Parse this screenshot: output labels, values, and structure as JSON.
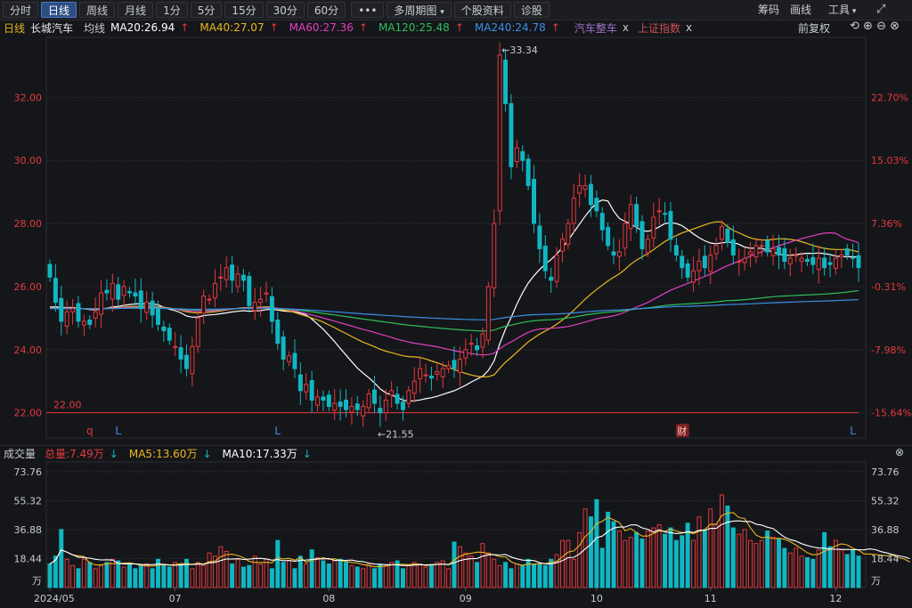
{
  "toolbar": {
    "periods": [
      "分时",
      "日线",
      "周线",
      "月线",
      "1分",
      "5分",
      "15分",
      "30分",
      "60分"
    ],
    "active": "日线",
    "more": "•••",
    "multi": "多周期图",
    "profile": "个股资料",
    "diagnose": "诊股",
    "chips": "筹码",
    "draw": "画线",
    "tools": "工具"
  },
  "info": {
    "period": "日线",
    "stock": "长城汽车",
    "avg": "均线",
    "ma20": "MA20:26.94",
    "ma40": "MA40:27.07",
    "ma60": "MA60:27.36",
    "ma120": "MA120:25.48",
    "ma240": "MA240:24.78",
    "overlay1": "汽车整车",
    "overlay2": "上证指数",
    "close_mark": "x",
    "adjust": "前复权"
  },
  "vol_info": {
    "title": "成交量",
    "total": "总量:7.49万",
    "ma5": "MA5:13.60万",
    "ma10": "MA10:17.33万"
  },
  "colors": {
    "up": "#e4393c",
    "down": "#10b7c2",
    "ma20": "#ffffff",
    "ma40": "#e8b820",
    "ma60": "#e040c0",
    "ma120": "#2fbf5a",
    "ma240": "#3a8ee6",
    "ref_line": "#e4393c"
  },
  "chart_data": {
    "type": "candlestick",
    "price_axis": {
      "ylim": [
        21.2,
        33.9
      ],
      "ticks": [
        "32.00",
        "30.00",
        "28.00",
        "26.00",
        "24.00",
        "22.00"
      ],
      "tick_values": [
        32,
        30,
        28,
        26,
        24,
        22
      ],
      "pct_ticks": [
        "22.70%",
        "15.03%",
        "7.36%",
        "-0.31%",
        "-7.98%",
        "-15.64%"
      ]
    },
    "ref_line": {
      "value": 22.0,
      "label": "22.00"
    },
    "annotations": {
      "high": {
        "value": 33.34,
        "label": "←33.34"
      },
      "low": {
        "value": 21.55,
        "label": "←21.55"
      }
    },
    "markers": [
      {
        "label": "q",
        "index": 7
      },
      {
        "label": "L",
        "index": 12
      },
      {
        "label": "L",
        "index": 40
      },
      {
        "label": "财",
        "index": 111
      },
      {
        "label": "L",
        "index": 141
      }
    ],
    "x_labels": [
      {
        "label": "2024/05",
        "index": 0
      },
      {
        "label": "07",
        "index": 22
      },
      {
        "label": "08",
        "index": 49
      },
      {
        "label": "09",
        "index": 73
      },
      {
        "label": "10",
        "index": 96
      },
      {
        "label": "11",
        "index": 116
      },
      {
        "label": "12",
        "index": 138
      }
    ],
    "closes": [
      26.3,
      25.5,
      24.9,
      25.2,
      25.3,
      24.9,
      24.9,
      24.8,
      25.2,
      25.8,
      25.8,
      26.1,
      25.6,
      26.0,
      25.8,
      25.7,
      25.3,
      25.5,
      25.1,
      24.8,
      24.6,
      24.3,
      24.1,
      23.7,
      23.4,
      24.1,
      25.0,
      25.7,
      25.6,
      26.1,
      26.3,
      26.6,
      26.2,
      26.4,
      26.2,
      25.4,
      25.5,
      25.6,
      25.8,
      24.9,
      24.2,
      23.7,
      23.8,
      23.4,
      22.7,
      22.9,
      22.4,
      22.5,
      22.4,
      22.2,
      22.3,
      22.2,
      22.1,
      22.2,
      22.1,
      22.2,
      22.6,
      22.3,
      22.0,
      22.4,
      22.7,
      22.3,
      22.1,
      22.7,
      23.0,
      23.4,
      23.2,
      23.1,
      23.3,
      23.4,
      23.5,
      23.4,
      23.7,
      24.0,
      24.2,
      24.0,
      24.5,
      26.0,
      28.0,
      33.34,
      31.8,
      29.8,
      30.4,
      30.0,
      29.2,
      28.0,
      27.2,
      26.5,
      26.2,
      27.0,
      27.5,
      28.0,
      28.8,
      29.2,
      29.2,
      28.6,
      28.4,
      27.8,
      27.3,
      27.0,
      27.1,
      28.0,
      28.6,
      27.9,
      27.2,
      27.5,
      28.2,
      28.4,
      28.3,
      27.5,
      27.0,
      26.6,
      26.3,
      26.5,
      26.8,
      26.6,
      27.0,
      27.3,
      27.9,
      27.4,
      27.0,
      26.8,
      26.9,
      27.1,
      27.3,
      27.3,
      27.1,
      27.2,
      27.0,
      26.8,
      26.9,
      27.0,
      26.9,
      26.8,
      26.7,
      26.9,
      26.6,
      26.7,
      26.9,
      27.0,
      27.0,
      26.9,
      26.6
    ],
    "volume_axis": {
      "ylim": [
        0,
        80
      ],
      "ticks": [
        "73.76",
        "55.32",
        "36.88",
        "18.44"
      ],
      "tick_values": [
        73.76,
        55.32,
        36.88,
        18.44
      ],
      "unit": "万"
    },
    "volumes": [
      15,
      20,
      37,
      18,
      14,
      12,
      18,
      16,
      12,
      14,
      16,
      18,
      17,
      13,
      15,
      12,
      14,
      15,
      12,
      18,
      14,
      13,
      16,
      15,
      18,
      12,
      16,
      14,
      22,
      20,
      26,
      23,
      15,
      18,
      13,
      14,
      20,
      15,
      18,
      12,
      30,
      16,
      17,
      12,
      20,
      15,
      24,
      19,
      17,
      15,
      17,
      18,
      16,
      14,
      13,
      12,
      15,
      12,
      15,
      14,
      16,
      17,
      12,
      14,
      16,
      15,
      13,
      14,
      16,
      17,
      12,
      29,
      26,
      22,
      20,
      16,
      28,
      22,
      18,
      14,
      16,
      12,
      15,
      14,
      18,
      15,
      15,
      14,
      18,
      21,
      30,
      30,
      18,
      35,
      50,
      45,
      56,
      25,
      48,
      42,
      36,
      30,
      32,
      35,
      31,
      36,
      38,
      40,
      34,
      38,
      30,
      33,
      41,
      30,
      45,
      36,
      50,
      40,
      59,
      52,
      38,
      34,
      37,
      30,
      28,
      30,
      36,
      32,
      31,
      25,
      22,
      25,
      20,
      19,
      18,
      24,
      35,
      26,
      30,
      24,
      21,
      24,
      20,
      18,
      24,
      19,
      22,
      18,
      20,
      16,
      15,
      12
    ]
  }
}
